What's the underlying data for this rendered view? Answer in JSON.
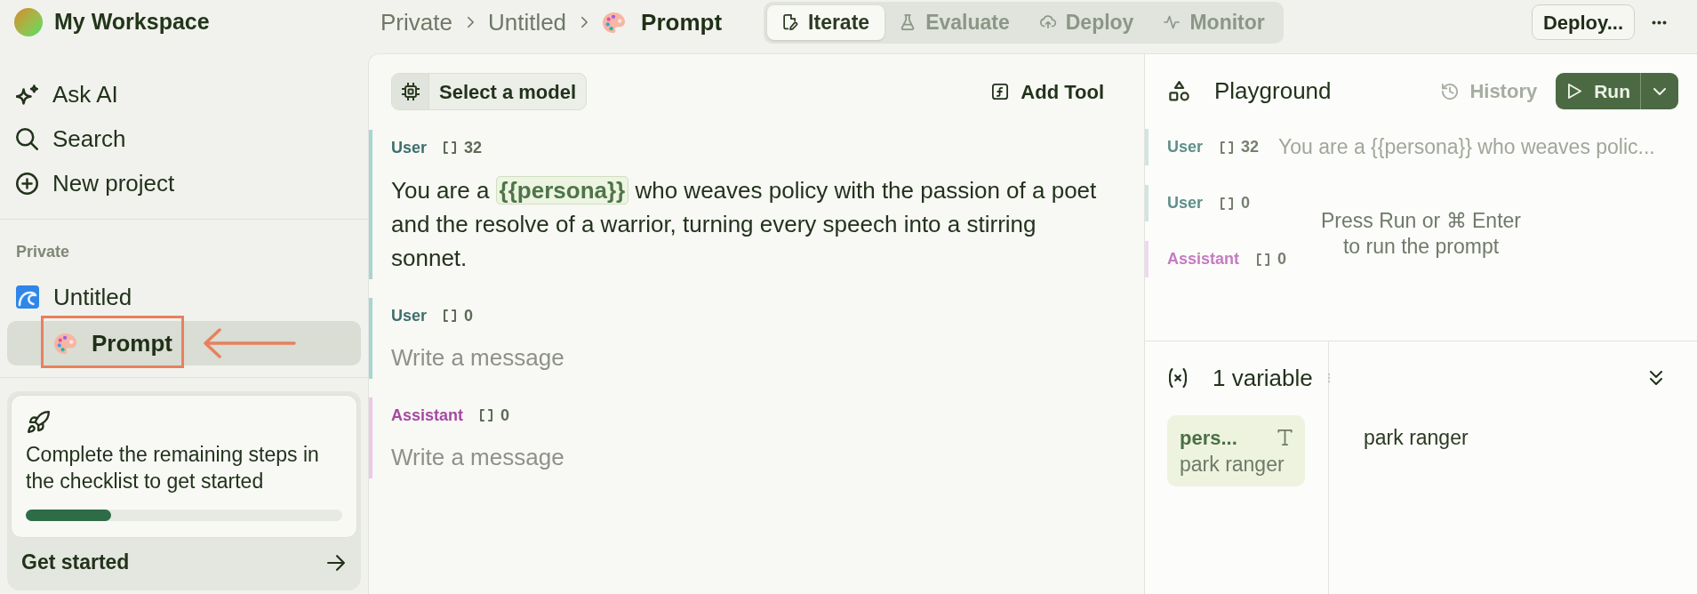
{
  "workspace": {
    "name": "My Workspace"
  },
  "sidebar": {
    "actions": [
      {
        "label": "Ask AI"
      },
      {
        "label": "Search"
      },
      {
        "label": "New project"
      }
    ],
    "section": "Private",
    "tree": [
      {
        "label": "Untitled",
        "selected": false,
        "children": [
          {
            "label": "Prompt",
            "selected": true,
            "annotated": true
          }
        ]
      }
    ],
    "checklist": {
      "text": "Complete the remaining steps in the checklist to get started",
      "progress": {
        "level": 0.27
      },
      "action": "Get started"
    }
  },
  "header": {
    "breadcrumb": [
      {
        "label": "Private",
        "current": false
      },
      {
        "label": "Untitled",
        "current": false
      },
      {
        "label": "Prompt",
        "current": true
      }
    ],
    "tabs": [
      {
        "label": "Iterate",
        "selected": true
      },
      {
        "label": "Evaluate",
        "selected": false
      },
      {
        "label": "Deploy",
        "selected": false
      },
      {
        "label": "Monitor",
        "selected": false
      }
    ],
    "deploy_button": "Deploy..."
  },
  "editor": {
    "model_button": "Select a model",
    "add_tool": "Add Tool",
    "messages": [
      {
        "kind": "user",
        "role": "User",
        "tokens": "32",
        "content": [
          {
            "kind": "text",
            "value": "You are a "
          },
          {
            "kind": "variable",
            "value": "{{persona}}"
          },
          {
            "kind": "text",
            "value": " who weaves policy with the passion of a poet and the resolve of a warrior, turning every speech into a stirring sonnet."
          }
        ]
      },
      {
        "kind": "user",
        "role": "User",
        "tokens": "0",
        "placeholder": "Write a message"
      },
      {
        "kind": "assistant",
        "role": "Assistant",
        "tokens": "0",
        "placeholder": "Write a message"
      }
    ]
  },
  "playground": {
    "title": "Playground",
    "history": {
      "label": "History",
      "disabled": true
    },
    "run_button": "Run",
    "messages": [
      {
        "kind": "user",
        "role": "User",
        "tokens": "32",
        "preview": "You are a {{persona}} who weaves polic..."
      },
      {
        "kind": "user",
        "role": "User",
        "tokens": "0"
      },
      {
        "kind": "assistant",
        "role": "Assistant",
        "tokens": "0"
      }
    ],
    "hint": "Press Run or ⌘ Enter to run the prompt"
  },
  "variables": {
    "title": "1 variable",
    "items": [
      {
        "name": "pers...",
        "kind": "text",
        "value": "park ranger",
        "selected": true
      }
    ],
    "value": "park ranger"
  }
}
